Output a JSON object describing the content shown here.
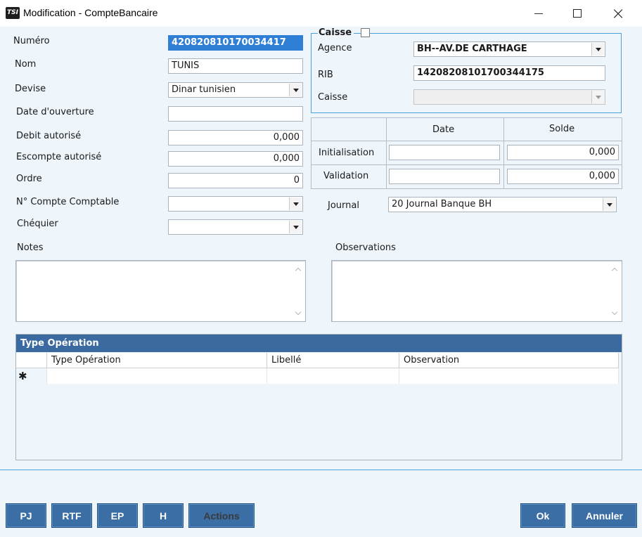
{
  "window": {
    "icon_text": "TSI",
    "title": "Modification - CompteBancaire"
  },
  "form": {
    "numero_label": "Numéro",
    "numero_value": "420820810170034417",
    "nom_label": "Nom",
    "nom_value": "TUNIS",
    "devise_label": "Devise",
    "devise_value": "Dinar tunisien",
    "date_ouverture_label": "Date d'ouverture",
    "date_ouverture_value": "",
    "debit_label": "Debit autorisé",
    "debit_value": "0,000",
    "escompte_label": "Escompte autorisé",
    "escompte_value": "0,000",
    "ordre_label": "Ordre",
    "ordre_value": "0",
    "compte_label": "N° Compte Comptable",
    "compte_value": "",
    "chequier_label": "Chéquier",
    "chequier_value": "",
    "notes_label": "Notes",
    "observations_label": "Observations"
  },
  "caisse_group": {
    "title": "Caisse",
    "agence_label": "Agence",
    "agence_value": "BH--AV.DE CARTHAGE",
    "rib_label": "RIB",
    "rib_value": "14208208101700344175",
    "caisse_label": "Caisse",
    "caisse_value": ""
  },
  "grid": {
    "col_date": "Date",
    "col_solde": "Solde",
    "row_init": "Initialisation",
    "row_valid": "Validation",
    "init_date": "",
    "init_solde": "0,000",
    "valid_date": "",
    "valid_solde": "0,000"
  },
  "journal": {
    "label": "Journal",
    "value": "20  Journal Banque BH"
  },
  "type_operation": {
    "title": "Type Opération",
    "columns": [
      "Type Opération",
      "Libellé",
      "Observation"
    ],
    "new_row_marker": "✱"
  },
  "buttons": {
    "pj": "PJ",
    "rtf": "RTF",
    "ep": "EP",
    "h": "H",
    "actions": "Actions",
    "ok": "Ok",
    "annuler": "Annuler"
  },
  "icons": {
    "close": "×",
    "dropdown": "chevron-down-icon"
  }
}
